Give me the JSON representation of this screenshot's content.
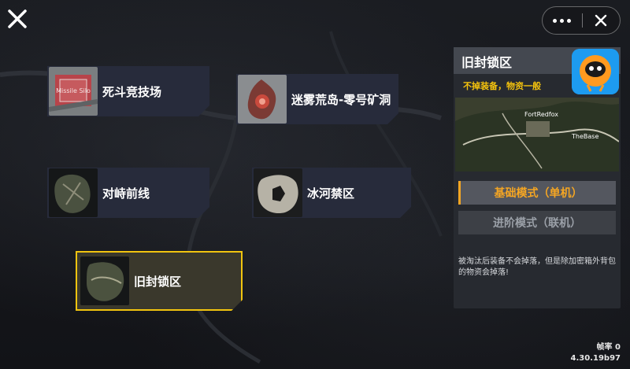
{
  "maps": [
    {
      "name": "死斗竞技场",
      "thumb": "arena-thumb",
      "thumb_text": "Missile Silo"
    },
    {
      "name": "迷雾荒岛-零号矿洞",
      "thumb": "island-thumb"
    },
    {
      "name": "对峙前线",
      "thumb": "front-thumb"
    },
    {
      "name": "冰河禁区",
      "thumb": "glacier-thumb"
    },
    {
      "name": "旧封锁区",
      "thumb": "lockdown-thumb",
      "selected": true
    }
  ],
  "panel": {
    "title": "旧封锁区",
    "subtitle": "不掉装备，物资一般",
    "map_labels": [
      "FortRedfox",
      "TheBase"
    ],
    "modes": [
      {
        "label": "基础模式（单机）",
        "active": true
      },
      {
        "label": "进阶模式（联机）",
        "active": false
      }
    ],
    "note": "被淘汰后装备不会掉落，但是除加密箱外背包的物资会掉落!"
  },
  "footer": {
    "fps_label": "帧率 0",
    "version": "4.30.19b97"
  },
  "icons": {
    "close": "close-icon",
    "more": "more-dots-icon",
    "capsule_close": "close-icon",
    "app": "mascot-app-icon"
  },
  "colors": {
    "accent": "#f1c40f",
    "mode_active": "#f5a623",
    "card_bg": "#272b3b"
  }
}
